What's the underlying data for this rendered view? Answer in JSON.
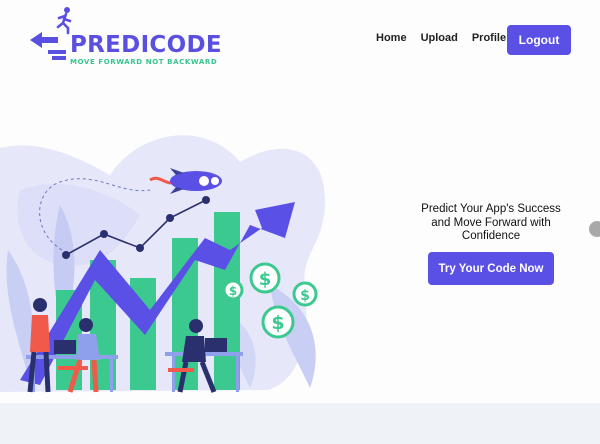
{
  "brand": {
    "name": "PREDICODE",
    "tagline": "MOVE FORWARD NOT BACKWARD",
    "primary_color": "#5b50e6",
    "accent_color": "#37c58f"
  },
  "nav": {
    "links": [
      "Home",
      "Upload",
      "Profile"
    ],
    "logout_label": "Logout"
  },
  "hero": {
    "headline": "Predict Your App's Success and Move Forward with Confidence",
    "cta_label": "Try Your Code Now",
    "illustration": "growth-chart-team-illustration"
  }
}
